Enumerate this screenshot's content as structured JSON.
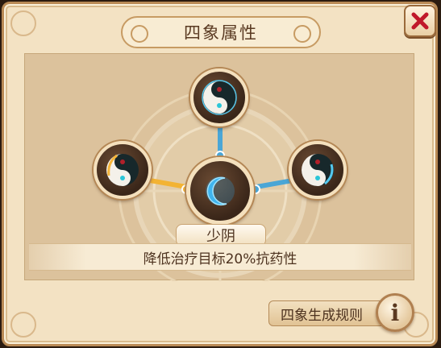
{
  "dialog": {
    "title": "四象属性",
    "close_icon": "close-x-icon"
  },
  "wheel": {
    "top_node_icon": "yin-yang-icon",
    "left_node_icon": "yin-yang-fire-icon",
    "right_node_icon": "yin-yang-water-icon",
    "center_node_icon": "crescent-moon-icon"
  },
  "selected": {
    "name": "少阴",
    "description": "降低治疗目标20%抗药性"
  },
  "footer": {
    "rules_label": "四象生成规则",
    "info_icon": "info-icon",
    "info_glyph": "i"
  },
  "colors": {
    "accent_blue": "#4aa6d6",
    "accent_gold": "#f3b333",
    "close_red": "#c0182a"
  }
}
